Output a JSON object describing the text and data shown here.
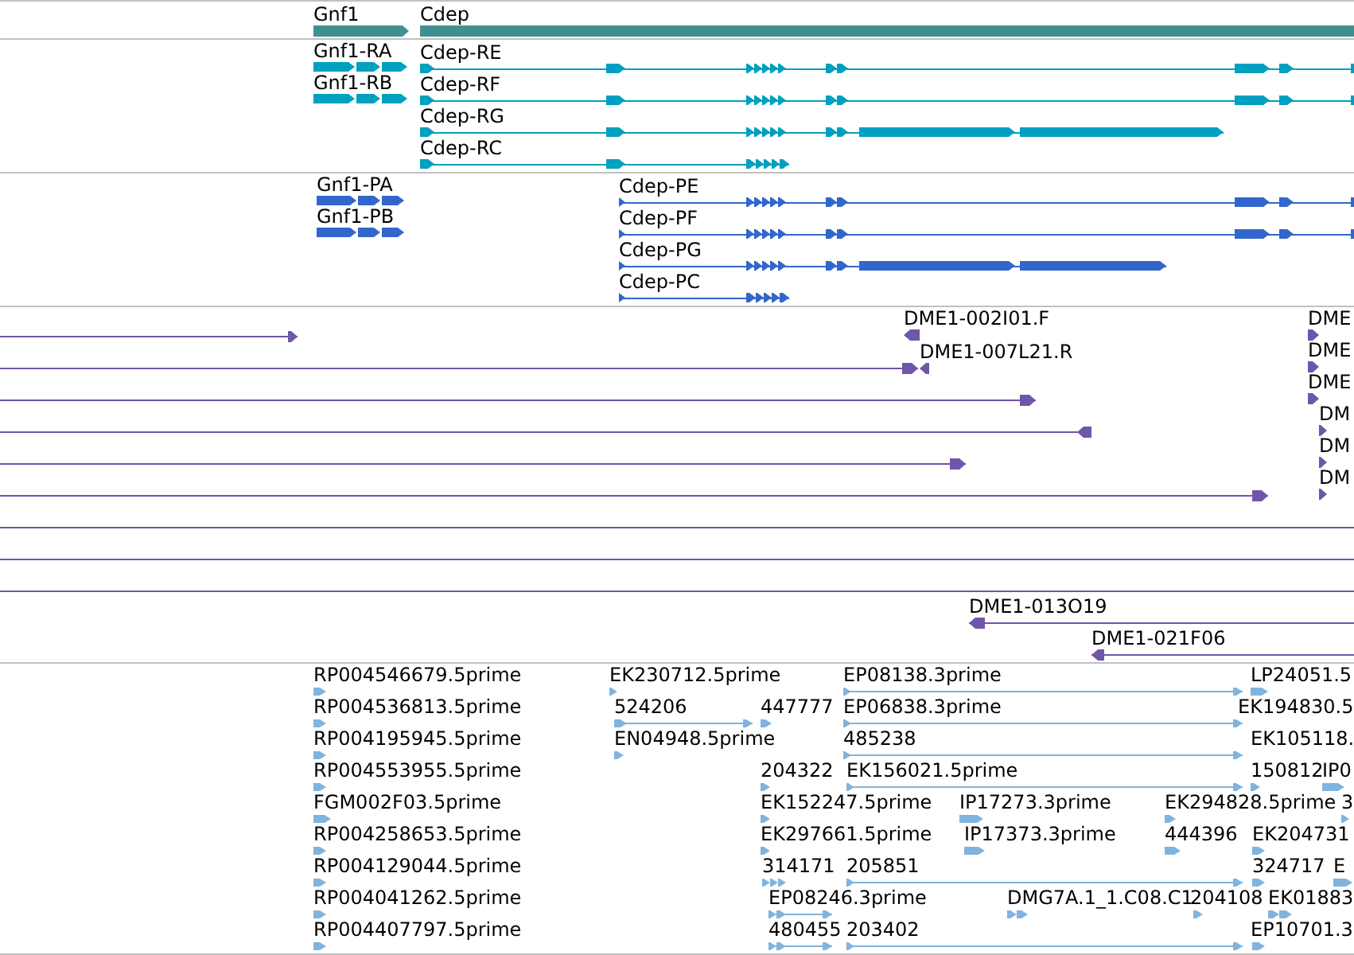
{
  "tracks": [
    {
      "color": "#409090",
      "features": [
        {
          "label": "Gnf1",
          "kind": "bar",
          "reverse": false
        },
        {
          "label": "Cdep",
          "kind": "bar"
        }
      ]
    },
    {
      "color": "#00a0c0",
      "features": [
        {
          "label": "Gnf1-RA",
          "kind": "bar",
          "reverse": false
        },
        {
          "label": "Cdep-RE",
          "kind": "span",
          "reverse": false
        },
        {
          "label": "Gnf1-RB",
          "kind": "bar",
          "reverse": false
        },
        {
          "label": "Cdep-RF",
          "kind": "span",
          "reverse": false
        },
        {
          "label": "Cdep-RG",
          "kind": "span",
          "reverse": false
        },
        {
          "label": "Cdep-RC",
          "kind": "span",
          "reverse": false
        }
      ]
    },
    {
      "color": "#3366cc",
      "features": [
        {
          "label": "Gnf1-PA",
          "kind": "bar",
          "reverse": false
        },
        {
          "label": "Cdep-PE",
          "kind": "span",
          "reverse": false
        },
        {
          "label": "Gnf1-PB",
          "kind": "bar",
          "reverse": false
        },
        {
          "label": "Cdep-PF",
          "kind": "span",
          "reverse": false
        },
        {
          "label": "Cdep-PG",
          "kind": "span",
          "reverse": false
        },
        {
          "label": "Cdep-PC",
          "kind": "span",
          "reverse": false
        }
      ]
    },
    {
      "color": "#6f56a8",
      "features": [
        {
          "kind": "span",
          "reverse": false
        },
        {
          "label": "DME1-002I01.F",
          "kind": "bar",
          "reverse": true
        },
        {
          "label": "DME",
          "kind": "bar",
          "reverse": false
        },
        {
          "kind": "span",
          "reverse": false
        },
        {
          "label": "DME1-007L21.R",
          "kind": "bar",
          "reverse": true
        },
        {
          "label": "DME",
          "kind": "bar",
          "reverse": false
        },
        {
          "kind": "span",
          "reverse": false
        },
        {
          "label": "DME",
          "kind": "bar",
          "reverse": false
        },
        {
          "kind": "span",
          "reverse": true
        },
        {
          "label": "DM",
          "kind": "bar",
          "reverse": false
        },
        {
          "kind": "span",
          "reverse": false
        },
        {
          "label": "DM",
          "kind": "bar",
          "reverse": false
        },
        {
          "kind": "span",
          "reverse": false
        },
        {
          "label": "DM",
          "kind": "bar",
          "reverse": false
        },
        {
          "kind": "line"
        },
        {
          "kind": "line"
        },
        {
          "kind": "line"
        },
        {
          "label": "DME1-013O19",
          "kind": "span",
          "reverse": true
        },
        {
          "label": "DME1-021F06",
          "kind": "span",
          "reverse": true
        }
      ]
    },
    {
      "color": "#80b4de",
      "features": [
        {
          "label": "RP004546679.5prime",
          "kind": "bar",
          "reverse": false
        },
        {
          "label": "EK230712.5prime",
          "kind": "bar",
          "reverse": false
        },
        {
          "label": "EP08138.3prime",
          "kind": "span",
          "reverse": false
        },
        {
          "label": "LP24051.5",
          "kind": "bar",
          "reverse": false
        },
        {
          "label": "RP004536813.5prime",
          "kind": "bar",
          "reverse": false
        },
        {
          "label": "524206",
          "kind": "span",
          "reverse": false
        },
        {
          "label": "447777",
          "kind": "bar",
          "reverse": false
        },
        {
          "label": "EP06838.3prime",
          "kind": "span",
          "reverse": false
        },
        {
          "label": "EK194830.5"
        },
        {
          "label": "RP004195945.5prime",
          "kind": "bar",
          "reverse": false
        },
        {
          "label": "EN04948.5prime",
          "kind": "bar",
          "reverse": false
        },
        {
          "label": "485238",
          "kind": "span",
          "reverse": false
        },
        {
          "label": "EK105118."
        },
        {
          "label": "RP004553955.5prime",
          "kind": "bar",
          "reverse": false
        },
        {
          "label": "204322",
          "kind": "bar",
          "reverse": false
        },
        {
          "label": "EK156021.5prime",
          "kind": "span",
          "reverse": false
        },
        {
          "label": "150812",
          "kind": "bar",
          "reverse": false
        },
        {
          "label": "IP0",
          "kind": "bar",
          "reverse": false
        },
        {
          "label": "FGM002F03.5prime",
          "kind": "bar",
          "reverse": false
        },
        {
          "label": "EK152247.5prime",
          "kind": "bar",
          "reverse": false
        },
        {
          "label": "IP17273.3prime",
          "kind": "bar",
          "reverse": false
        },
        {
          "label": "EK294828.5prime",
          "kind": "bar",
          "reverse": false
        },
        {
          "label": "3",
          "kind": "bar",
          "reverse": false
        },
        {
          "label": "RP004258653.5prime",
          "kind": "bar",
          "reverse": false
        },
        {
          "label": "EK297661.5prime",
          "kind": "bar",
          "reverse": false
        },
        {
          "label": "IP17373.3prime",
          "kind": "bar",
          "reverse": false
        },
        {
          "label": "444396",
          "kind": "bar",
          "reverse": false
        },
        {
          "label": "EK204731",
          "kind": "bar",
          "reverse": false
        },
        {
          "label": "RP004129044.5prime",
          "kind": "bar",
          "reverse": false
        },
        {
          "label": "314171",
          "kind": "bar",
          "reverse": false
        },
        {
          "label": "205851",
          "kind": "span",
          "reverse": false
        },
        {
          "label": "324717",
          "kind": "bar",
          "reverse": false
        },
        {
          "label": "E",
          "kind": "bar",
          "reverse": false
        },
        {
          "label": "RP004041262.5prime",
          "kind": "bar",
          "reverse": false
        },
        {
          "label": "EP08246.3prime",
          "kind": "span",
          "reverse": false
        },
        {
          "label": "DMG7A.1_1.C08.C1",
          "kind": "bar",
          "reverse": false
        },
        {
          "label": "204108",
          "kind": "bar",
          "reverse": false
        },
        {
          "label": "EK01883",
          "kind": "bar",
          "reverse": false
        },
        {
          "label": "RP004407797.5prime",
          "kind": "bar",
          "reverse": false
        },
        {
          "label": "480455",
          "kind": "span",
          "reverse": false
        },
        {
          "label": "203402",
          "kind": "span",
          "reverse": false
        },
        {
          "label": "EP10701.3",
          "kind": "bar",
          "reverse": false
        }
      ]
    }
  ]
}
